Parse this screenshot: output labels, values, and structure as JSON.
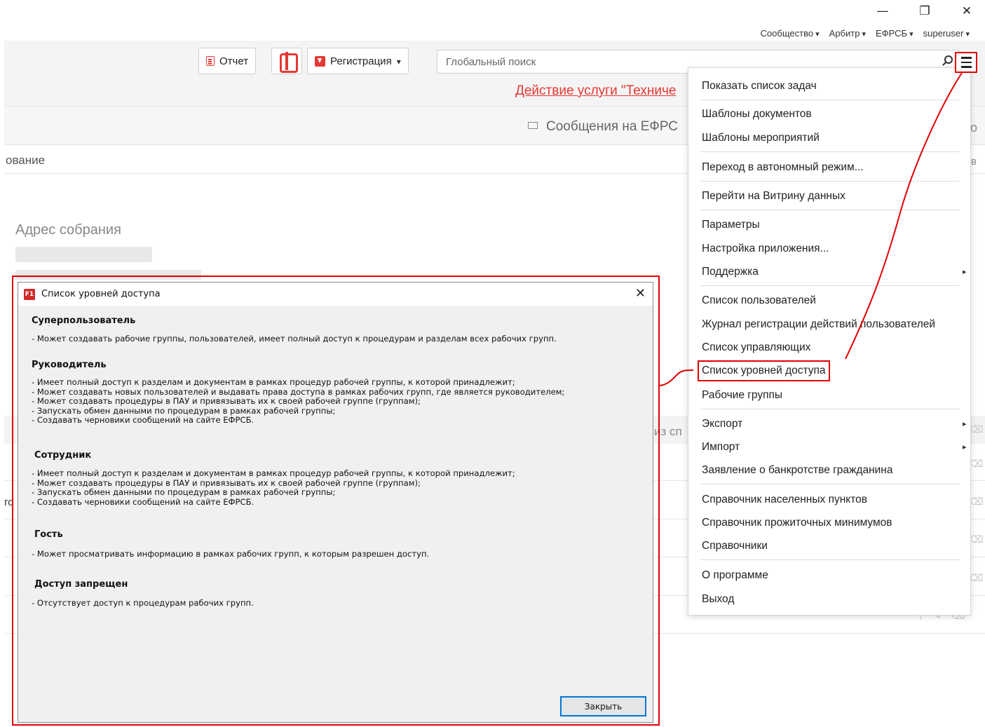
{
  "window_controls": {
    "minimize": "—",
    "maximize": "❐",
    "close": "✕"
  },
  "top_links": [
    "Сообщество",
    "Арбитр",
    "ЕФРСБ",
    "superuser"
  ],
  "toolbar": {
    "report_label": "Отчет",
    "registration_label": "Регистрация",
    "search_placeholder": "Глобальный поиск"
  },
  "notice": "Действие услуги \"Техниче",
  "background": {
    "messages_tab": "Сообщения на ЕФРС",
    "row_label": "ование",
    "address_label": "Адрес собрания",
    "trunc_b": "в",
    "trunc_o": "о",
    "trunc_iz": "из сп",
    "trunc_go": "го"
  },
  "menu": {
    "items": [
      "Показать список задач",
      "Шаблоны документов",
      "Шаблоны мероприятий",
      "Переход в автономный режим...",
      "Перейти на Витрину данных",
      "Параметры",
      "Настройка приложения...",
      "Поддержка",
      "Список пользователей",
      "Журнал регистрации действий пользователей",
      "Список управляющих",
      "Список уровней доступа",
      "Рабочие группы",
      "Экспорт",
      "Импорт",
      "Заявление о банкротстве гражданина",
      "Справочник населенных пунктов",
      "Справочник прожиточных минимумов",
      "Справочники",
      "О программе",
      "Выход"
    ]
  },
  "dialog": {
    "icon_text": "F1",
    "title": "Список уровней доступа",
    "close_icon": "✕",
    "roles": [
      {
        "name": "Суперпользователь",
        "text": "- Может создавать рабочие группы, пользователей, имеет полный доступ к процедурам и разделам всех рабочих групп."
      },
      {
        "name": "Руководитель",
        "text": "- Имеет полный доступ к разделам и документам в рамках процедур рабочей группы, к которой принадлежит;\n- Может создавать новых пользователей и выдавать права доступа в рамках рабочих групп, где является руководителем;\n- Может создавать процедуры в ПАУ и привязывать их к своей рабочей группе (группам);\n- Запускать обмен данными по процедурам в рамках рабочей группы;\n- Создавать черновики сообщений на сайте ЕФРСБ."
      },
      {
        "name": "Сотрудник",
        "text": "- Имеет полный доступ к разделам и документам в рамках процедур рабочей группы, к которой принадлежит;\n- Может создавать процедуры в ПАУ и привязывать их к своей рабочей группе (группам);\n- Запускать обмен данными по процедурам в рамках рабочей группы;\n- Создавать черновики сообщений на сайте ЕФРСБ."
      },
      {
        "name": "Гость",
        "text": "- Может просматривать информацию в рамках рабочих групп, к которым разрешен доступ."
      },
      {
        "name": "Доступ запрещен",
        "text": "- Отсутствует доступ к процедурам рабочих групп."
      }
    ],
    "close_button": "Закрыть"
  }
}
